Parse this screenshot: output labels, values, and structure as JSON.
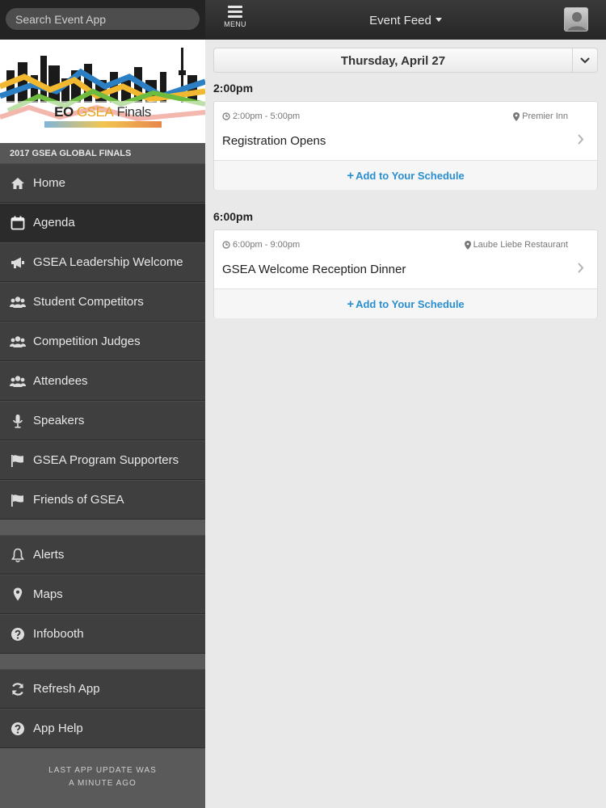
{
  "search": {
    "placeholder": "Search Event App"
  },
  "banner": {
    "logo_eo": "EO",
    "logo_gsea": "GSEA",
    "logo_finals": "Finals"
  },
  "event_header": "2017 GSEA GLOBAL FINALS",
  "nav_main": [
    {
      "label": "Home",
      "icon": "home-icon"
    },
    {
      "label": "Agenda",
      "icon": "calendar-icon",
      "active": true
    },
    {
      "label": "GSEA Leadership Welcome",
      "icon": "megaphone-icon"
    },
    {
      "label": "Student Competitors",
      "icon": "group-icon"
    },
    {
      "label": "Competition Judges",
      "icon": "group-icon"
    },
    {
      "label": "Attendees",
      "icon": "group-icon"
    },
    {
      "label": "Speakers",
      "icon": "microphone-icon"
    },
    {
      "label": "GSEA Program Supporters",
      "icon": "flag-icon"
    },
    {
      "label": "Friends of GSEA",
      "icon": "flag-icon"
    }
  ],
  "nav_tools": [
    {
      "label": "Alerts",
      "icon": "bell-icon"
    },
    {
      "label": "Maps",
      "icon": "map-pin-icon"
    },
    {
      "label": "Infobooth",
      "icon": "question-icon"
    }
  ],
  "nav_app": [
    {
      "label": "Refresh App",
      "icon": "refresh-icon"
    },
    {
      "label": "App Help",
      "icon": "question-icon"
    }
  ],
  "footer": {
    "line1": "LAST APP UPDATE WAS",
    "line2": "A MINUTE AGO"
  },
  "topbar": {
    "menu_label": "MENU",
    "title": "Event Feed"
  },
  "date": "Thursday, April 27",
  "sessions": [
    {
      "heading": "2:00pm",
      "time": "2:00pm - 5:00pm",
      "location": "Premier Inn",
      "title": "Registration Opens",
      "action": "Add to Your Schedule"
    },
    {
      "heading": "6:00pm",
      "time": "6:00pm - 9:00pm",
      "location": "Laube Liebe Restaurant",
      "title": "GSEA Welcome Reception Dinner",
      "action": "Add to Your Schedule"
    }
  ],
  "colors": {
    "accent": "#2a8fd1",
    "sidebar": "#3f3f3f",
    "topbar": "#2b2b2b"
  }
}
